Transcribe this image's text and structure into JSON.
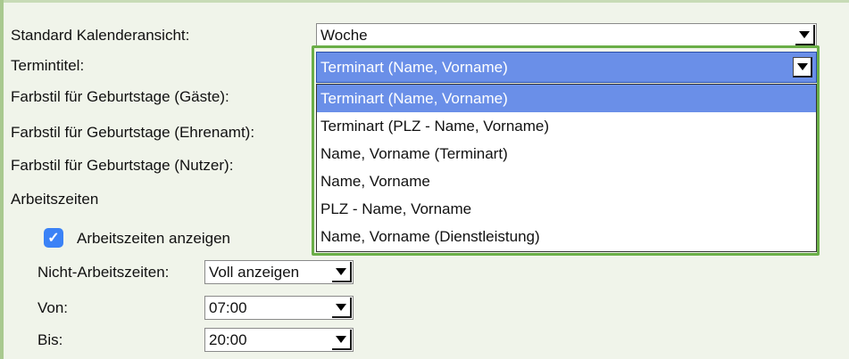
{
  "labels": {
    "standard_view": "Standard Kalenderansicht:",
    "termintitel": "Termintitel:",
    "farbstil_gaeste": "Farbstil für Geburtstage (Gäste):",
    "farbstil_ehrenamt": "Farbstil für Geburtstage (Ehrenamt):",
    "farbstil_nutzer": "Farbstil für Geburtstage (Nutzer):",
    "arbeitszeiten": "Arbeitszeiten",
    "arbeitszeiten_anzeigen": "Arbeitszeiten anzeigen",
    "nicht_arbeitszeiten": "Nicht-Arbeitszeiten:",
    "von": "Von:",
    "bis": "Bis:"
  },
  "selects": {
    "standard_view": "Woche",
    "termintitel": "Terminart (Name, Vorname)",
    "nicht_arbeitszeiten": "Voll anzeigen",
    "von": "07:00",
    "bis": "20:00"
  },
  "checkbox": {
    "arbeitszeiten_anzeigen_checked": true
  },
  "dropdown": {
    "options": [
      "Terminart (Name, Vorname)",
      "Terminart (PLZ - Name, Vorname)",
      "Name, Vorname (Terminart)",
      "Name, Vorname",
      "PLZ - Name, Vorname",
      "Name, Vorname (Dienstleistung)"
    ],
    "selected_index": 0
  },
  "colors": {
    "accent": "#6a8fe8",
    "highlight_border": "#6aae47",
    "checkbox": "#3b82f6"
  },
  "icons": {
    "select_arrow": "chevron-down-icon",
    "checkbox": "checkmark-icon"
  }
}
